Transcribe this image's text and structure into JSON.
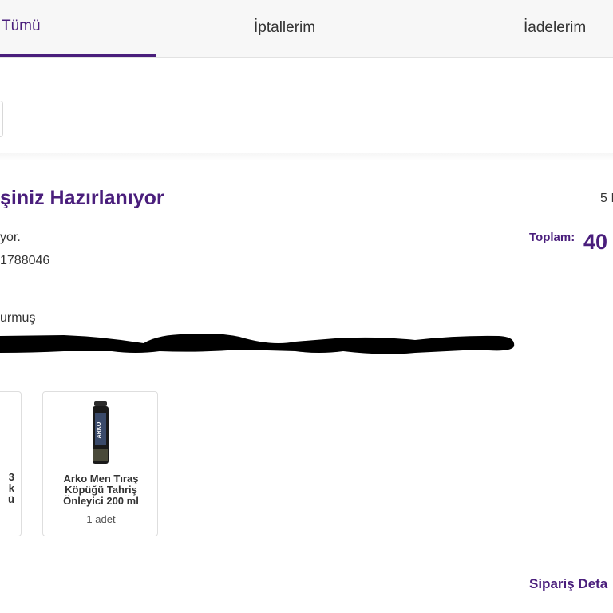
{
  "tabs": {
    "all": "Tümü",
    "cancellations": "İptallerim",
    "returns": "İadelerim"
  },
  "order": {
    "status_title": "şiniz Hazırlanıyor",
    "date_partial": "5 I",
    "status_sub": "yor.",
    "order_number": "1788046",
    "total_label": "Toplam:",
    "total_value": "40",
    "delivery_status": "urmuş",
    "details_link": "Sipariş Deta"
  },
  "products": [
    {
      "name_partial": "3\nk\nü",
      "icon": "product-thumbnail"
    },
    {
      "name": "Arko Men Tıraş Köpüğü Tahriş Önleyici 200 ml",
      "quantity": "1 adet",
      "image_text": "ARKO",
      "icon": "shaving-foam-can"
    }
  ],
  "colors": {
    "accent": "#4a1e7c",
    "tab_bg": "#f7f7f7",
    "border": "#dedede",
    "text": "#333333",
    "redaction": "#000000"
  }
}
